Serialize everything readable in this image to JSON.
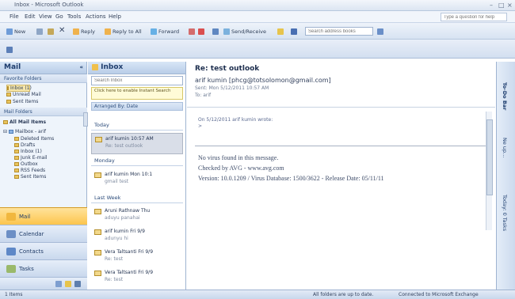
{
  "window": {
    "title": "Inbox - Microsoft Outlook"
  },
  "menu": {
    "items": [
      "File",
      "Edit",
      "View",
      "Go",
      "Tools",
      "Actions",
      "Help"
    ],
    "help_placeholder": "Type a question for help"
  },
  "toolbar": {
    "new": "New",
    "reply": "Reply",
    "reply_all": "Reply to All",
    "forward": "Forward",
    "send_receive": "Send/Receive",
    "search_placeholder": "Search address books"
  },
  "nav": {
    "title": "Mail",
    "favorites_header": "Favorite Folders",
    "favorites": [
      "Inbox (1)",
      "Unread Mail",
      "Sent Items"
    ],
    "mail_folders_header": "Mail Folders",
    "all_mail": "All Mail Items",
    "mailbox": "Mailbox - arif",
    "folders": [
      "Deleted Items",
      "Drafts",
      "Inbox (1)",
      "Junk E-mail",
      "Outbox",
      "RSS Feeds",
      "Sent Items"
    ],
    "buttons": [
      "Mail",
      "Calendar",
      "Contacts",
      "Tasks"
    ]
  },
  "list": {
    "title": "Inbox",
    "search_placeholder": "Search Inbox",
    "fast_search": "Click here to enable Instant Search",
    "arranged": "Arranged By: Date",
    "groups": {
      "today": "Today",
      "monday": "Monday",
      "last_week": "Last Week"
    },
    "items": [
      {
        "from": "arif kumin",
        "time": "10:57 AM",
        "subject": "Re: test outlook"
      },
      {
        "from": "arif kumin",
        "time": "Mon 10:1",
        "subject": "gmail test"
      },
      {
        "from": "Aruni Rathnaw",
        "time": "Thu",
        "subject": "aduyu panahai"
      },
      {
        "from": "arif kumin",
        "time": "Fri 9/9",
        "subject": "adunyu hi"
      },
      {
        "from": "Vera Taltsanti",
        "time": "Fri 9/9",
        "subject": "Re: test"
      },
      {
        "from": "Vera Taltsanti",
        "time": "Fri 9/9",
        "subject": "Re: test"
      }
    ]
  },
  "reading": {
    "subject": "Re: test outlook",
    "from": "arif kumin [phcg@totsolomon@gmail.com]",
    "sent": "Sent: Mon 5/12/2011 10:57 AM",
    "to": "To: arif",
    "quote": "On 5/12/2011 arif kumin wrote:",
    "quote2": ">",
    "av_line1": "No virus found in this message.",
    "av_line2": "Checked by AVG - www.avg.com",
    "av_line3": "Version: 10.0.1209 / Virus Database: 1500/3622 - Release Date: 05/11/11"
  },
  "todo": {
    "labels": [
      "To-Do Bar",
      "Ne up...",
      "Today: 0 Tasks"
    ]
  },
  "status": {
    "left": "1 Items",
    "right1": "All folders are up to date.",
    "right2": "Connected to Microsoft Exchange"
  },
  "colors": {
    "accent": "#fcc54d",
    "chrome": "#cddcf0",
    "title_blue": "#1e3d6d"
  }
}
